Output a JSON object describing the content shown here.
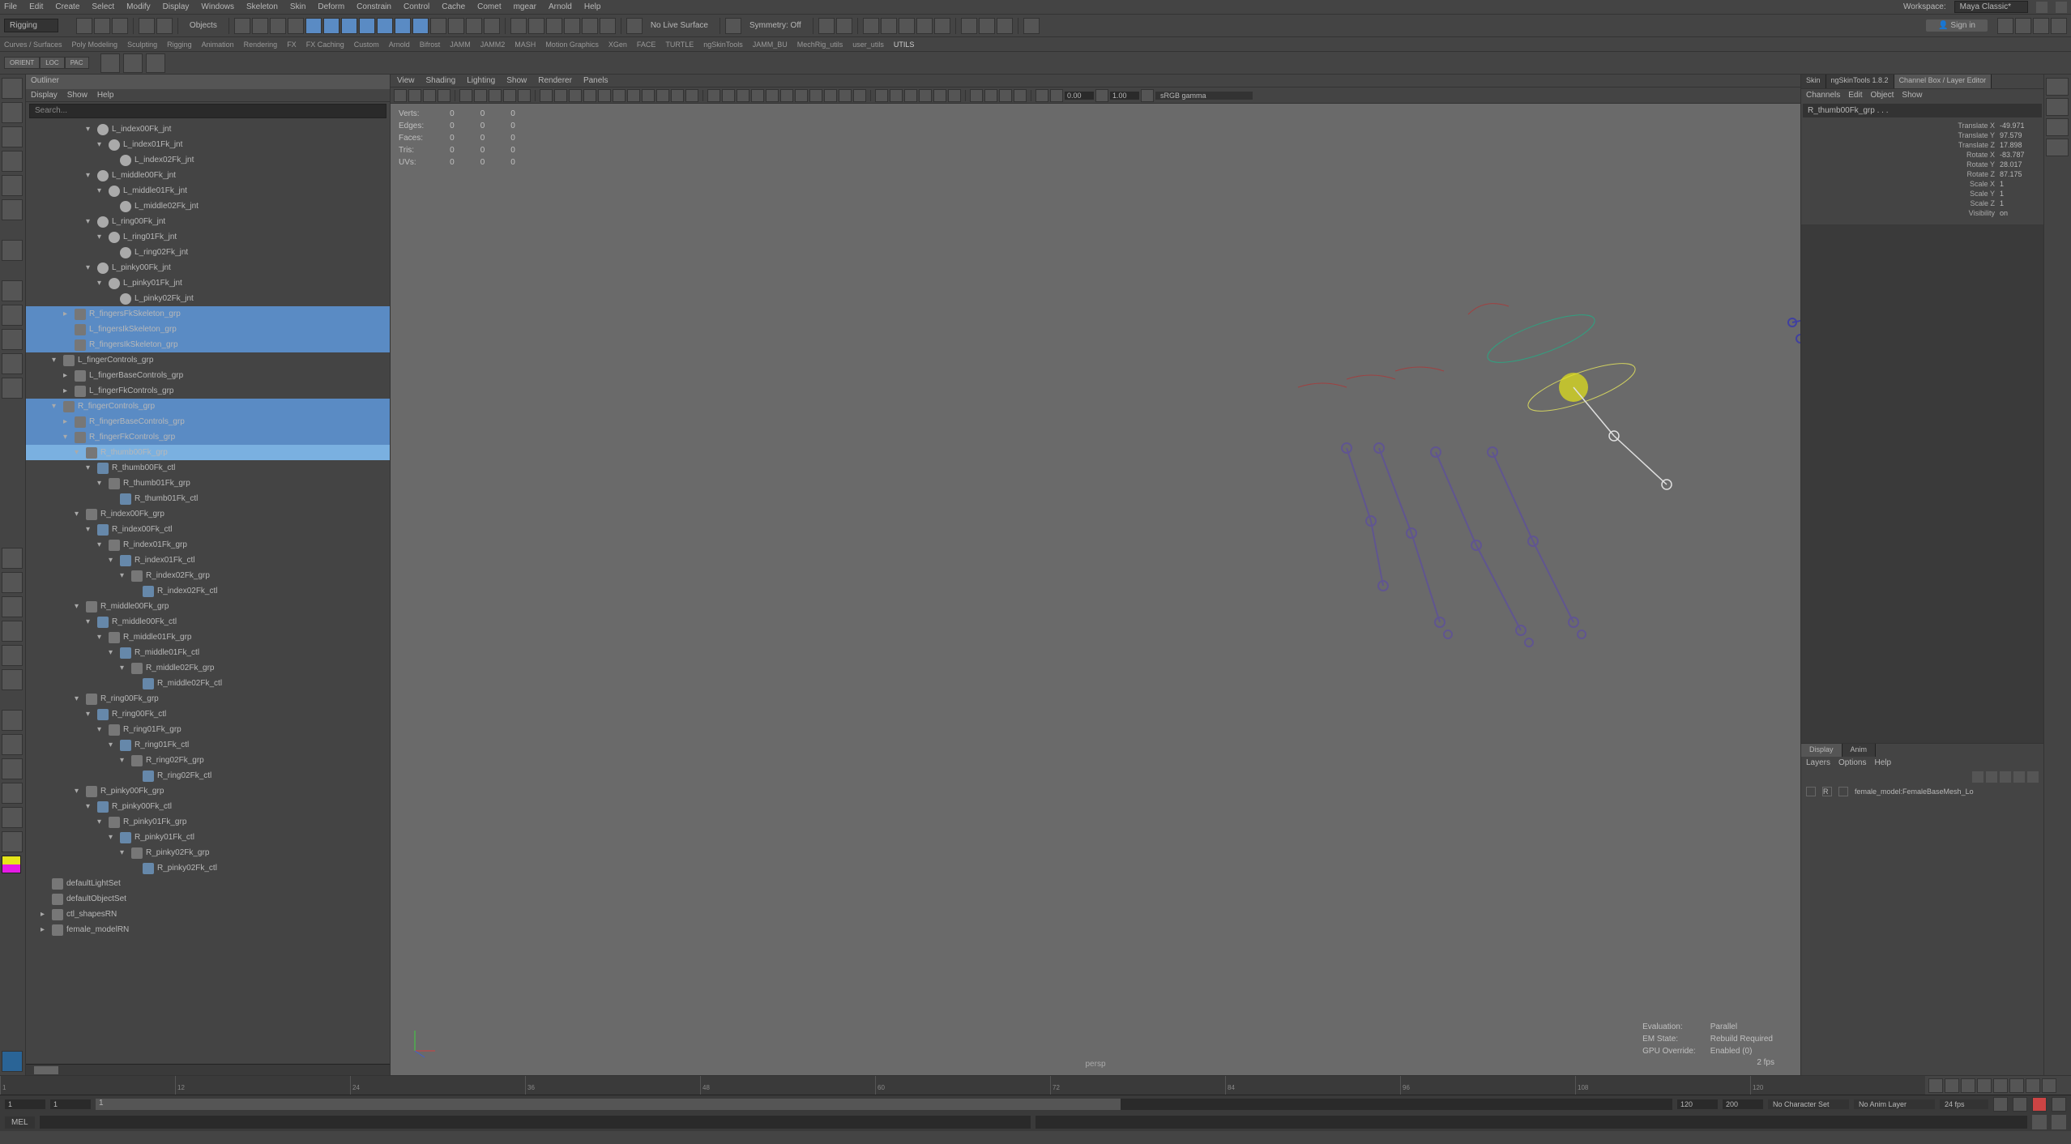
{
  "menubar": [
    "File",
    "Edit",
    "Create",
    "Select",
    "Modify",
    "Display",
    "Windows",
    "Skeleton",
    "Skin",
    "Deform",
    "Constrain",
    "Control",
    "Cache",
    "Comet",
    "mgear",
    "Arnold",
    "Help"
  ],
  "workspace_label": "Workspace:",
  "workspace_value": "Maya Classic*",
  "module_selector": "Rigging",
  "toolbar_text": {
    "objects": "Objects",
    "no_live": "No Live Surface",
    "symmetry": "Symmetry: Off",
    "signin": "Sign in"
  },
  "shelf_tabs": [
    "Curves / Surfaces",
    "Poly Modeling",
    "Sculpting",
    "Rigging",
    "Animation",
    "Rendering",
    "FX",
    "FX Caching",
    "Custom",
    "Arnold",
    "Bifrost",
    "JAMM",
    "JAMM2",
    "MASH",
    "Motion Graphics",
    "XGen",
    "FACE",
    "TURTLE",
    "ngSkinTools",
    "JAMM_BU",
    "MechRig_utils",
    "user_utils",
    "UTILS"
  ],
  "mode_tabs": [
    "ORIENT",
    "LOC",
    "PAC"
  ],
  "outliner": {
    "title": "Outliner",
    "menu": [
      "Display",
      "Show",
      "Help"
    ],
    "search": "Search...",
    "items": [
      {
        "depth": 5,
        "type": "jnt",
        "label": "L_index00Fk_jnt",
        "exp": "-"
      },
      {
        "depth": 6,
        "type": "jnt",
        "label": "L_index01Fk_jnt",
        "exp": "-"
      },
      {
        "depth": 7,
        "type": "jnt",
        "label": "L_index02Fk_jnt",
        "exp": ""
      },
      {
        "depth": 5,
        "type": "jnt",
        "label": "L_middle00Fk_jnt",
        "exp": "-"
      },
      {
        "depth": 6,
        "type": "jnt",
        "label": "L_middle01Fk_jnt",
        "exp": "-"
      },
      {
        "depth": 7,
        "type": "jnt",
        "label": "L_middle02Fk_jnt",
        "exp": ""
      },
      {
        "depth": 5,
        "type": "jnt",
        "label": "L_ring00Fk_jnt",
        "exp": "-"
      },
      {
        "depth": 6,
        "type": "jnt",
        "label": "L_ring01Fk_jnt",
        "exp": "-"
      },
      {
        "depth": 7,
        "type": "jnt",
        "label": "L_ring02Fk_jnt",
        "exp": ""
      },
      {
        "depth": 5,
        "type": "jnt",
        "label": "L_pinky00Fk_jnt",
        "exp": "-"
      },
      {
        "depth": 6,
        "type": "jnt",
        "label": "L_pinky01Fk_jnt",
        "exp": "-"
      },
      {
        "depth": 7,
        "type": "jnt",
        "label": "L_pinky02Fk_jnt",
        "exp": ""
      },
      {
        "depth": 3,
        "type": "grp",
        "label": "R_fingersFkSkeleton_grp",
        "exp": "+",
        "sel": "sel1"
      },
      {
        "depth": 3,
        "type": "grp",
        "label": "L_fingersIkSkeleton_grp",
        "exp": "",
        "sel": "sel1"
      },
      {
        "depth": 3,
        "type": "grp",
        "label": "R_fingersIkSkeleton_grp",
        "exp": "",
        "sel": "sel1"
      },
      {
        "depth": 2,
        "type": "grp",
        "label": "L_fingerControls_grp",
        "exp": "-"
      },
      {
        "depth": 3,
        "type": "grp",
        "label": "L_fingerBaseControls_grp",
        "exp": "+"
      },
      {
        "depth": 3,
        "type": "grp",
        "label": "L_fingerFkControls_grp",
        "exp": "+"
      },
      {
        "depth": 2,
        "type": "grp",
        "label": "R_fingerControls_grp",
        "exp": "-",
        "sel": "sel1"
      },
      {
        "depth": 3,
        "type": "grp",
        "label": "R_fingerBaseControls_grp",
        "exp": "+",
        "sel": "sel1"
      },
      {
        "depth": 3,
        "type": "grp",
        "label": "R_fingerFkControls_grp",
        "exp": "-",
        "sel": "sel1"
      },
      {
        "depth": 4,
        "type": "grp",
        "label": "R_thumb00Fk_grp",
        "exp": "-",
        "sel": "sel2"
      },
      {
        "depth": 5,
        "type": "ctl",
        "label": "R_thumb00Fk_ctl",
        "exp": "-"
      },
      {
        "depth": 6,
        "type": "grp",
        "label": "R_thumb01Fk_grp",
        "exp": "-"
      },
      {
        "depth": 7,
        "type": "ctl",
        "label": "R_thumb01Fk_ctl",
        "exp": ""
      },
      {
        "depth": 4,
        "type": "grp",
        "label": "R_index00Fk_grp",
        "exp": "-"
      },
      {
        "depth": 5,
        "type": "ctl",
        "label": "R_index00Fk_ctl",
        "exp": "-"
      },
      {
        "depth": 6,
        "type": "grp",
        "label": "R_index01Fk_grp",
        "exp": "-"
      },
      {
        "depth": 7,
        "type": "ctl",
        "label": "R_index01Fk_ctl",
        "exp": "-"
      },
      {
        "depth": 8,
        "type": "grp",
        "label": "R_index02Fk_grp",
        "exp": "-"
      },
      {
        "depth": 9,
        "type": "ctl",
        "label": "R_index02Fk_ctl",
        "exp": ""
      },
      {
        "depth": 4,
        "type": "grp",
        "label": "R_middle00Fk_grp",
        "exp": "-"
      },
      {
        "depth": 5,
        "type": "ctl",
        "label": "R_middle00Fk_ctl",
        "exp": "-"
      },
      {
        "depth": 6,
        "type": "grp",
        "label": "R_middle01Fk_grp",
        "exp": "-"
      },
      {
        "depth": 7,
        "type": "ctl",
        "label": "R_middle01Fk_ctl",
        "exp": "-"
      },
      {
        "depth": 8,
        "type": "grp",
        "label": "R_middle02Fk_grp",
        "exp": "-"
      },
      {
        "depth": 9,
        "type": "ctl",
        "label": "R_middle02Fk_ctl",
        "exp": ""
      },
      {
        "depth": 4,
        "type": "grp",
        "label": "R_ring00Fk_grp",
        "exp": "-"
      },
      {
        "depth": 5,
        "type": "ctl",
        "label": "R_ring00Fk_ctl",
        "exp": "-"
      },
      {
        "depth": 6,
        "type": "grp",
        "label": "R_ring01Fk_grp",
        "exp": "-"
      },
      {
        "depth": 7,
        "type": "ctl",
        "label": "R_ring01Fk_ctl",
        "exp": "-"
      },
      {
        "depth": 8,
        "type": "grp",
        "label": "R_ring02Fk_grp",
        "exp": "-"
      },
      {
        "depth": 9,
        "type": "ctl",
        "label": "R_ring02Fk_ctl",
        "exp": ""
      },
      {
        "depth": 4,
        "type": "grp",
        "label": "R_pinky00Fk_grp",
        "exp": "-"
      },
      {
        "depth": 5,
        "type": "ctl",
        "label": "R_pinky00Fk_ctl",
        "exp": "-"
      },
      {
        "depth": 6,
        "type": "grp",
        "label": "R_pinky01Fk_grp",
        "exp": "-"
      },
      {
        "depth": 7,
        "type": "ctl",
        "label": "R_pinky01Fk_ctl",
        "exp": "-"
      },
      {
        "depth": 8,
        "type": "grp",
        "label": "R_pinky02Fk_grp",
        "exp": "-"
      },
      {
        "depth": 9,
        "type": "ctl",
        "label": "R_pinky02Fk_ctl",
        "exp": ""
      },
      {
        "depth": 1,
        "type": "grp",
        "label": "defaultLightSet",
        "exp": ""
      },
      {
        "depth": 1,
        "type": "grp",
        "label": "defaultObjectSet",
        "exp": ""
      },
      {
        "depth": 1,
        "type": "grp",
        "label": "ctl_shapesRN",
        "exp": "+"
      },
      {
        "depth": 1,
        "type": "grp",
        "label": "female_modelRN",
        "exp": "+"
      }
    ]
  },
  "viewport": {
    "menu": [
      "View",
      "Shading",
      "Lighting",
      "Show",
      "Renderer",
      "Panels"
    ],
    "field1": "0.00",
    "field2": "1.00",
    "color_space": "sRGB gamma",
    "hud": [
      {
        "k": "Verts:",
        "v1": "0",
        "v2": "0",
        "v3": "0"
      },
      {
        "k": "Edges:",
        "v1": "0",
        "v2": "0",
        "v3": "0"
      },
      {
        "k": "Faces:",
        "v1": "0",
        "v2": "0",
        "v3": "0"
      },
      {
        "k": "Tris:",
        "v1": "0",
        "v2": "0",
        "v3": "0"
      },
      {
        "k": "UVs:",
        "v1": "0",
        "v2": "0",
        "v3": "0"
      }
    ],
    "camera": "persp",
    "status": [
      {
        "k": "Evaluation:",
        "v": "Parallel"
      },
      {
        "k": "EM State:",
        "v": "Rebuild Required"
      },
      {
        "k": "GPU Override:",
        "v": "Enabled (0)"
      }
    ],
    "fps": "2 fps"
  },
  "right": {
    "tabs": [
      "Skin",
      "ngSkinTools 1.8.2",
      "Channel Box / Layer Editor"
    ],
    "menu": [
      "Channels",
      "Edit",
      "Object",
      "Show"
    ],
    "sel_name": "R_thumb00Fk_grp . . .",
    "attrs": [
      {
        "k": "Translate X",
        "v": "-49.971"
      },
      {
        "k": "Translate Y",
        "v": "97.579"
      },
      {
        "k": "Translate Z",
        "v": "17.898"
      },
      {
        "k": "Rotate X",
        "v": "-83.787"
      },
      {
        "k": "Rotate Y",
        "v": "28.017"
      },
      {
        "k": "Rotate Z",
        "v": "87.175"
      },
      {
        "k": "Scale X",
        "v": "1"
      },
      {
        "k": "Scale Y",
        "v": "1"
      },
      {
        "k": "Scale Z",
        "v": "1"
      },
      {
        "k": "Visibility",
        "v": "on"
      }
    ],
    "layer_tabs": [
      "Display",
      "Anim"
    ],
    "layer_menu": [
      "Layers",
      "Options",
      "Help"
    ],
    "layer_row": {
      "flag": "R",
      "name": "female_model:FemaleBaseMesh_Lo"
    }
  },
  "timeline": {
    "ticks": [
      "1",
      "12",
      "24",
      "36",
      "48",
      "60",
      "72",
      "84",
      "96",
      "108",
      "120"
    ],
    "range_start_outer": "1",
    "range_start_inner": "1",
    "range_cur": "1",
    "range_end_inner": "120",
    "range_end_outer": "200",
    "charset": "No Character Set",
    "animlayer": "No Anim Layer",
    "fps": "24 fps"
  },
  "cmd_lang": "MEL"
}
